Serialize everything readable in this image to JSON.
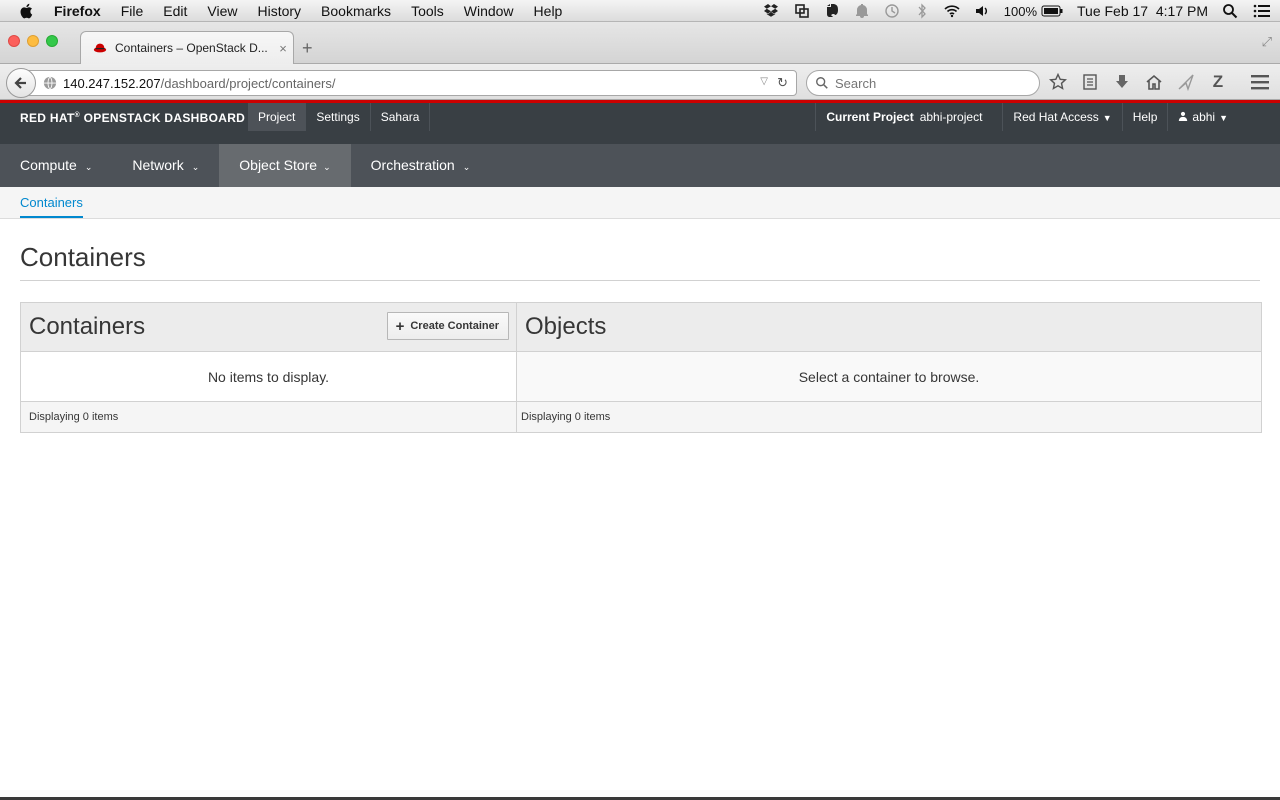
{
  "mac_menubar": {
    "app_name": "Firefox",
    "menus": [
      "File",
      "Edit",
      "View",
      "History",
      "Bookmarks",
      "Tools",
      "Window",
      "Help"
    ],
    "battery": "100%",
    "datetime": "Tue Feb 17  4:17 PM"
  },
  "browser": {
    "tab_title": "Containers – OpenStack D...",
    "tab_close": "×",
    "new_tab": "+",
    "url_host": "140.247.152.207",
    "url_path": "/dashboard/project/containers/",
    "search_placeholder": "Search"
  },
  "header": {
    "brand": "RED HAT",
    "brand_mark": "®",
    "brand_suffix": " OPENSTACK DASHBOARD",
    "top_nav": [
      "Project",
      "Settings",
      "Sahara"
    ],
    "current_project_label": "Current Project",
    "current_project": "abhi-project",
    "red_hat_access": "Red Hat Access",
    "help": "Help",
    "user": "abhi"
  },
  "secondary_nav": [
    "Compute",
    "Network",
    "Object Store",
    "Orchestration"
  ],
  "tertiary_nav": {
    "active": "Containers"
  },
  "page": {
    "title": "Containers",
    "containers_panel": {
      "title": "Containers",
      "create_button": "Create Container",
      "empty_message": "No items to display.",
      "footer": "Displaying 0 items"
    },
    "objects_panel": {
      "title": "Objects",
      "empty_message": "Select a container to browse.",
      "footer": "Displaying 0 items"
    }
  },
  "colors": {
    "header_bg": "#393f44",
    "accent_red": "#cc0000",
    "link_blue": "#0088ce",
    "secondary_nav_bg": "#4d5258"
  }
}
